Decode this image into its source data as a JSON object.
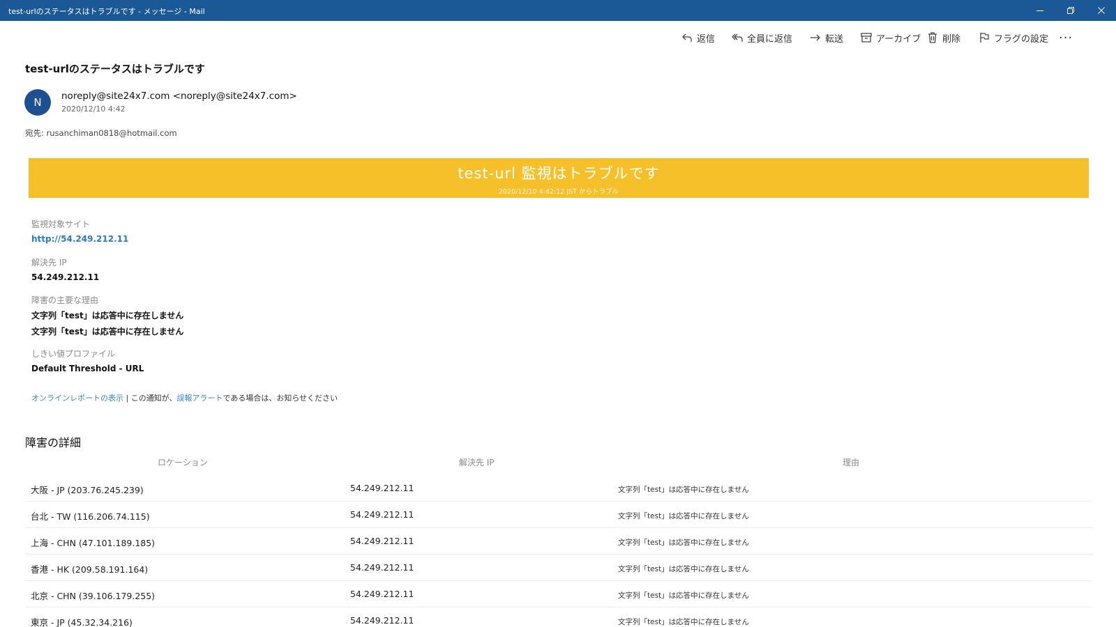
{
  "window": {
    "title": "test-urlのステータスはトラブルです - メッセージ - Mail"
  },
  "toolbar": {
    "reply": "返信",
    "reply_all": "全員に返信",
    "forward": "転送",
    "archive": "アーカイブ",
    "delete": "削除",
    "flag": "フラグの設定",
    "more": "···"
  },
  "message": {
    "subject": "test-urlのステータスはトラブルです",
    "avatar_letter": "N",
    "sender": "noreply@site24x7.com <noreply@site24x7.com>",
    "date": "2020/12/10 4:42",
    "to_label": "宛先:",
    "to": "rusanchiman0818@hotmail.com"
  },
  "banner": {
    "title": "test-url 監視はトラブルです",
    "subtitle": "2020/12/10 4:42:12 JST からトラブル",
    "color": "#f6c02b"
  },
  "fields": {
    "site_label": "監視対象サイト",
    "site_value": "http://54.249.212.11",
    "ip_label": "解決先 IP",
    "ip_value": "54.249.212.11",
    "reason_label": "障害の主要な理由",
    "reason_values": [
      "文字列「test」は応答中に存在しません",
      "文字列「test」は応答中に存在しません"
    ],
    "threshold_label": "しきい値プロファイル",
    "threshold_value": "Default Threshold - URL"
  },
  "links": {
    "report": "オンラインレポートの表示",
    "separator": " | ",
    "text1": "この通知が、",
    "false_alert": "誤報アラート",
    "text2": "である場合は、",
    "text3": "お知らせください"
  },
  "failures": {
    "title": "障害の詳細",
    "headers": {
      "location": "ロケーション",
      "ip": "解決先 IP",
      "reason": "理由"
    },
    "rows": [
      {
        "location": "大阪 - JP (203.76.245.239)",
        "ip": "54.249.212.11",
        "reason": "文字列「test」は応答中に存在しません"
      },
      {
        "location": "台北 - TW (116.206.74.115)",
        "ip": "54.249.212.11",
        "reason": "文字列「test」は応答中に存在しません"
      },
      {
        "location": "上海 - CHN (47.101.189.185)",
        "ip": "54.249.212.11",
        "reason": "文字列「test」は応答中に存在しません"
      },
      {
        "location": "香港 - HK (209.58.191.164)",
        "ip": "54.249.212.11",
        "reason": "文字列「test」は応答中に存在しません"
      },
      {
        "location": "北京 - CHN (39.106.179.255)",
        "ip": "54.249.212.11",
        "reason": "文字列「test」は応答中に存在しません"
      },
      {
        "location": "東京 - JP (45.32.34.216)",
        "ip": "54.249.212.11",
        "reason": "文字列「test」は応答中に存在しません"
      }
    ]
  }
}
